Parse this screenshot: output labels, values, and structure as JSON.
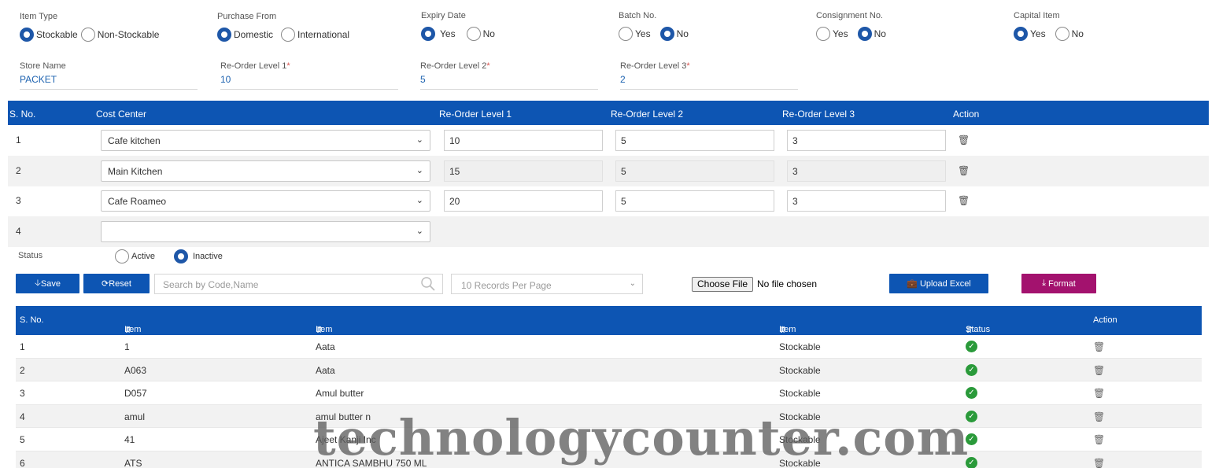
{
  "form": {
    "item_type": {
      "label": "Item Type",
      "options": [
        "Stockable",
        "Non-Stockable"
      ]
    },
    "purchase_from": {
      "label": "Purchase From",
      "options": [
        "Domestic",
        "International"
      ]
    },
    "expiry_date": {
      "label": "Expiry Date",
      "options": [
        "Yes",
        "No"
      ]
    },
    "batch_no": {
      "label": "Batch No.",
      "options": [
        "Yes",
        "No"
      ]
    },
    "consignment_no": {
      "label": "Consignment No.",
      "options": [
        "Yes",
        "No"
      ]
    },
    "capital_item": {
      "label": "Capital Item",
      "options": [
        "Yes",
        "No"
      ]
    },
    "store_name": {
      "label": "Store Name",
      "value": "PACKET"
    },
    "reorder1": {
      "label": "Re-Order Level 1",
      "value": "10"
    },
    "reorder2": {
      "label": "Re-Order Level 2",
      "value": "5"
    },
    "reorder3": {
      "label": "Re-Order Level 3",
      "value": "2"
    },
    "required_mark": "*"
  },
  "cost_table": {
    "headers": [
      "S. No.",
      "Cost Center",
      "Re-Order Level 1",
      "Re-Order Level 2",
      "Re-Order Level 3",
      "Action"
    ],
    "rows": [
      {
        "sno": "1",
        "center": "Cafe kitchen",
        "l1": "10",
        "l2": "5",
        "l3": "3"
      },
      {
        "sno": "2",
        "center": "Main Kitchen",
        "l1": "15",
        "l2": "5",
        "l3": "3"
      },
      {
        "sno": "3",
        "center": "Cafe Roameo",
        "l1": "20",
        "l2": "5",
        "l3": "3"
      },
      {
        "sno": "4",
        "center": ""
      }
    ]
  },
  "status": {
    "label": "Status",
    "options": [
      "Active",
      "Inactive"
    ]
  },
  "toolbar": {
    "save": "Save",
    "reset": "Reset",
    "search_placeholder": "Search by Code,Name",
    "per_page": "10 Records Per Page",
    "choose_file": "Choose File",
    "no_file": "No file chosen",
    "upload": "Upload Excel",
    "format": "Format"
  },
  "items_table": {
    "headers": [
      "S. No.",
      "Item Code",
      "Item Name",
      "Item Type",
      "Status",
      "Action"
    ],
    "rows": [
      {
        "sno": "1",
        "code": "1",
        "name": "Aata",
        "type": "Stockable"
      },
      {
        "sno": "2",
        "code": "A063",
        "name": "Aata",
        "type": "Stockable"
      },
      {
        "sno": "3",
        "code": "D057",
        "name": "Amul butter",
        "type": "Stockable"
      },
      {
        "sno": "4",
        "code": "amul",
        "name": "amul butter n",
        "type": "Stockable"
      },
      {
        "sno": "5",
        "code": "41",
        "name": "Ajeet Kanji Inc",
        "type": "Stockable"
      },
      {
        "sno": "6",
        "code": "ATS",
        "name": "ANTICA SAMBHU 750 ML",
        "type": "Stockable"
      }
    ]
  },
  "watermark": "technologycounter.com",
  "colors": {
    "primary": "#0d55b3",
    "format_button": "#a3126e",
    "status_ok": "#2a9a3a"
  }
}
